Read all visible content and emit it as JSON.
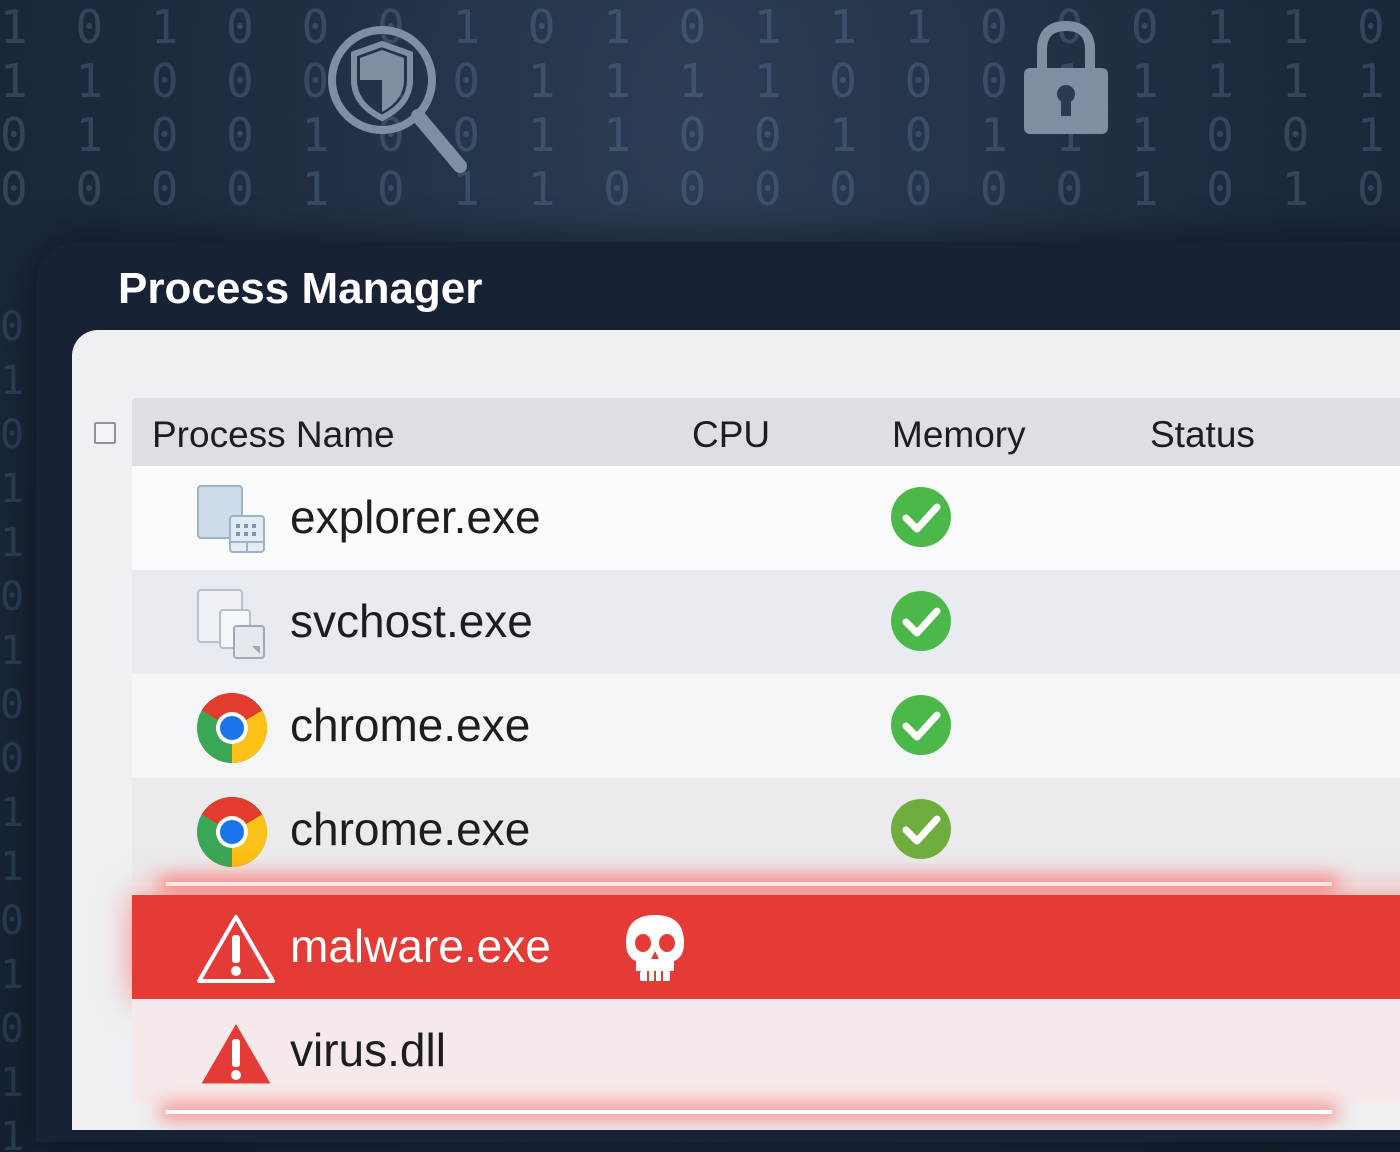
{
  "window": {
    "title": "Process Manager"
  },
  "table": {
    "columns": [
      "Process Name",
      "CPU",
      "Memory",
      "Status"
    ],
    "rows": [
      {
        "name": "explorer.exe",
        "icon": "explorer-app-icon",
        "status_icon": "green-check-icon",
        "state": "ok"
      },
      {
        "name": "svchost.exe",
        "icon": "svchost-app-icon",
        "status_icon": "green-check-icon",
        "state": "ok"
      },
      {
        "name": "chrome.exe",
        "icon": "chrome-icon",
        "status_icon": "green-check-icon",
        "state": "ok"
      },
      {
        "name": "chrome.exe",
        "icon": "chrome-icon",
        "status_icon": "green-check-icon",
        "state": "ok"
      },
      {
        "name": "malware.exe",
        "icon": "warning-triangle-icon",
        "status_icon": "skull-icon",
        "state": "threat"
      },
      {
        "name": "virus.dll",
        "icon": "warning-triangle-icon",
        "status_icon": "",
        "state": "threat"
      }
    ]
  },
  "colors": {
    "threat_row": "#e53b36",
    "check_green": "#4cb84a",
    "background": "#1c2a3e"
  },
  "background_icons": [
    "shield-search-icon",
    "lock-icon"
  ]
}
